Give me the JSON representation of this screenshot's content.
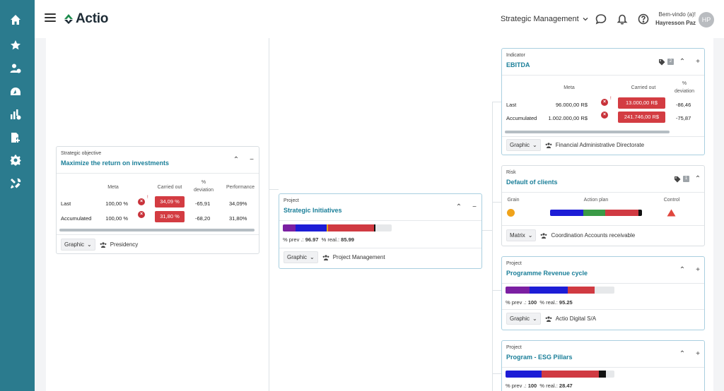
{
  "header": {
    "logo_text": "Actio",
    "module_select": "Strategic Management",
    "welcome_line1": "Bem-vindo (a)!",
    "welcome_line2": "Hayresson Paz",
    "avatar_initials": "HP"
  },
  "sidebar": {
    "icons": [
      "home-icon",
      "star-icon",
      "users-settings-icon",
      "dashboard-gauge-icon",
      "chart-settings-icon",
      "document-add-icon",
      "gear-icon",
      "tools-icon"
    ]
  },
  "objective": {
    "type": "Strategic objective",
    "title": "Maximize the return on investments",
    "columns": [
      "Meta",
      "Carried out",
      "%\ndeviation",
      "Performance"
    ],
    "rows": [
      {
        "label": "Last",
        "meta": "100,00 %",
        "carried": "34,09 %",
        "deviation": "-65,91",
        "performance": "34,09%"
      },
      {
        "label": "Accumulated",
        "meta": "100,00 %",
        "carried": "31,80 %",
        "deviation": "-68,20",
        "performance": "31,80%"
      }
    ],
    "view": "Graphic",
    "team": "Presidency"
  },
  "project_main": {
    "type": "Project",
    "title": "Strategic Initiatives",
    "prev_label": "% prev .:",
    "prev_value": "96.97",
    "real_label": "% real.:",
    "real_value": "85.99",
    "view": "Graphic",
    "team": "Project Management",
    "segments": [
      {
        "color": "#7b1fa2",
        "fraction": 0.12
      },
      {
        "color": "#1d1dd6",
        "fraction": 0.28
      },
      {
        "color": "#e8a317",
        "fraction": 0.015
      },
      {
        "color": "#d03a42",
        "fraction": 0.42
      },
      {
        "color": "#111111",
        "fraction": 0.015
      }
    ]
  },
  "indicator": {
    "type": "Indicator",
    "title": "EBITDA",
    "badge": "2",
    "columns": [
      "Meta",
      "Carried out",
      "%\ndeviation"
    ],
    "rows": [
      {
        "label": "Last",
        "meta": "96.000,00 R$",
        "carried": "13.000,00 R$",
        "deviation": "-86,46"
      },
      {
        "label": "Accumulated",
        "meta": "1.002.000,00 R$",
        "carried": "241.746,00 R$",
        "deviation": "-75,87"
      }
    ],
    "view": "Graphic",
    "team": "Financial Administrative Directorate"
  },
  "risk": {
    "type": "Risk",
    "title": "Default of clients",
    "badge": "1",
    "columns": [
      "Grain",
      "Action plan",
      "Control"
    ],
    "view": "Matrix",
    "team": "Coordination Accounts receivable",
    "segments": [
      {
        "color": "#1d1dd6",
        "fraction": 0.36
      },
      {
        "color": "#3a9a47",
        "fraction": 0.24
      },
      {
        "color": "#d03a42",
        "fraction": 0.36
      },
      {
        "color": "#111111",
        "fraction": 0.04
      }
    ]
  },
  "project_revenue": {
    "type": "Project",
    "title": "Programme Revenue cycle",
    "prev_label": "% prev .:",
    "prev_value": "100",
    "real_label": "% real.:",
    "real_value": "95.25",
    "view": "Graphic",
    "team": "Actio Digital S/A",
    "segments": [
      {
        "color": "#7b1fa2",
        "fraction": 0.22
      },
      {
        "color": "#1d1dd6",
        "fraction": 0.35
      },
      {
        "color": "#d03a42",
        "fraction": 0.25
      }
    ]
  },
  "project_esg": {
    "type": "Project",
    "title": "Program - ESG Pillars",
    "prev_label": "% prev .:",
    "prev_value": "100",
    "real_label": "% real.:",
    "real_value": "28.47",
    "segments": [
      {
        "color": "#1d1dd6",
        "fraction": 0.33
      },
      {
        "color": "#d03a42",
        "fraction": 0.53
      },
      {
        "color": "#111111",
        "fraction": 0.06
      }
    ]
  }
}
